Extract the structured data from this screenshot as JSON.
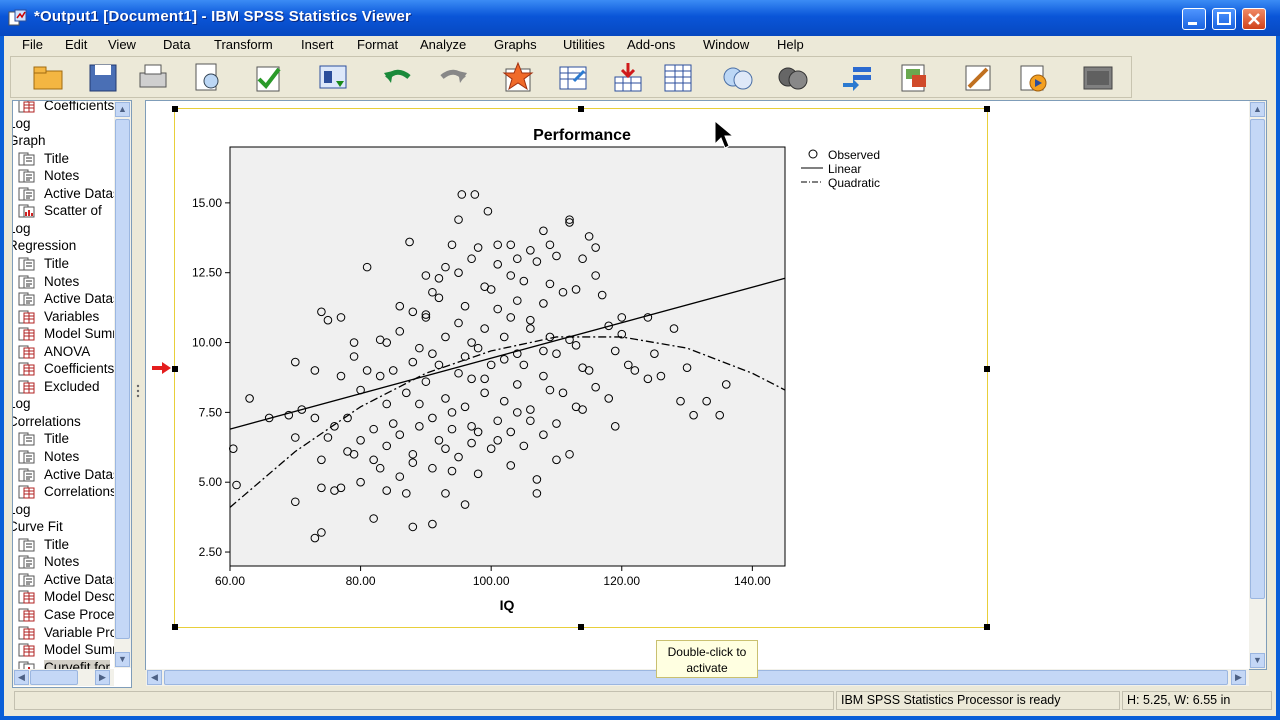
{
  "window": {
    "title": "*Output1 [Document1] - IBM SPSS Statistics Viewer",
    "app_icon": "spss-viewer-icon",
    "controls": [
      "minimize-icon",
      "maximize-icon",
      "close-icon"
    ]
  },
  "menu": [
    "File",
    "Edit",
    "View",
    "Data",
    "Transform",
    "Insert",
    "Format",
    "Analyze",
    "Graphs",
    "Utilities",
    "Add-ons",
    "Window",
    "Help"
  ],
  "toolbar": [
    "open-icon",
    "save-icon",
    "print-icon",
    "print-preview-icon",
    "export-icon",
    "recall-dialog-icon",
    "undo-icon",
    "redo-icon",
    "goto-data-icon",
    "goto-case-icon",
    "variables-icon",
    "insert-output-icon",
    "show-icon",
    "hide-icon",
    "promote-icon",
    "demote-icon",
    "insert-heading-icon",
    "insert-text-icon",
    "designate-window-icon"
  ],
  "nav": {
    "items": [
      {
        "label": "Coefficients",
        "type": "table"
      },
      {
        "label": "Log",
        "type": "log"
      },
      {
        "label": "Graph",
        "type": "section"
      },
      {
        "label": "Title",
        "type": "title"
      },
      {
        "label": "Notes",
        "type": "notes"
      },
      {
        "label": "Active Dataset",
        "type": "notes"
      },
      {
        "label": "Scatter of",
        "type": "chart"
      },
      {
        "label": "Log",
        "type": "log"
      },
      {
        "label": "Regression",
        "type": "section"
      },
      {
        "label": "Title",
        "type": "title"
      },
      {
        "label": "Notes",
        "type": "notes"
      },
      {
        "label": "Active Dataset",
        "type": "notes"
      },
      {
        "label": "Variables",
        "type": "table"
      },
      {
        "label": "Model Summary",
        "type": "table"
      },
      {
        "label": "ANOVA",
        "type": "table"
      },
      {
        "label": "Coefficients",
        "type": "table"
      },
      {
        "label": "Excluded",
        "type": "table"
      },
      {
        "label": "Log",
        "type": "log"
      },
      {
        "label": "Correlations",
        "type": "section"
      },
      {
        "label": "Title",
        "type": "title"
      },
      {
        "label": "Notes",
        "type": "notes"
      },
      {
        "label": "Active Dataset",
        "type": "notes"
      },
      {
        "label": "Correlations",
        "type": "table"
      },
      {
        "label": "Log",
        "type": "log"
      },
      {
        "label": "Curve Fit",
        "type": "section"
      },
      {
        "label": "Title",
        "type": "title"
      },
      {
        "label": "Notes",
        "type": "notes"
      },
      {
        "label": "Active Dataset",
        "type": "notes"
      },
      {
        "label": "Model Description",
        "type": "table"
      },
      {
        "label": "Case Processing",
        "type": "table"
      },
      {
        "label": "Variable Processing",
        "type": "table"
      },
      {
        "label": "Model Summary",
        "type": "table"
      },
      {
        "label": "Curvefit for",
        "type": "chart",
        "selected": true
      }
    ]
  },
  "chart_data": {
    "type": "scatter",
    "title": "Performance",
    "xlabel": "IQ",
    "ylabel": "",
    "xlim": [
      60,
      145
    ],
    "ylim": [
      2,
      17
    ],
    "xticks": [
      "60.00",
      "80.00",
      "100.00",
      "120.00",
      "140.00"
    ],
    "yticks": [
      "2.50",
      "5.00",
      "7.50",
      "10.00",
      "12.50",
      "15.00"
    ],
    "legend": {
      "position": "right",
      "entries": [
        "Observed",
        "Linear",
        "Quadratic"
      ]
    },
    "series": [
      {
        "name": "Linear",
        "style": "solid",
        "x": [
          60,
          145
        ],
        "y": [
          6.9,
          12.3
        ]
      },
      {
        "name": "Quadratic",
        "style": "dash-dot",
        "x": [
          60,
          70,
          80,
          90,
          100,
          110,
          120,
          130,
          140,
          145
        ],
        "y": [
          4.1,
          6.1,
          7.7,
          8.9,
          9.7,
          10.2,
          10.2,
          9.8,
          8.9,
          8.3
        ]
      },
      {
        "name": "Observed",
        "style": "circle",
        "points": [
          [
            95.5,
            15.3
          ],
          [
            97.5,
            15.3
          ],
          [
            99.5,
            14.7
          ],
          [
            112,
            14.4
          ],
          [
            95,
            14.4
          ],
          [
            112,
            14.3
          ],
          [
            108,
            14.0
          ],
          [
            115,
            13.8
          ],
          [
            87.5,
            13.6
          ],
          [
            94,
            13.5
          ],
          [
            101,
            13.5
          ],
          [
            103,
            13.5
          ],
          [
            109,
            13.5
          ],
          [
            116,
            13.4
          ],
          [
            98,
            13.4
          ],
          [
            106,
            13.3
          ],
          [
            110,
            13.1
          ],
          [
            114,
            13.0
          ],
          [
            107,
            12.9
          ],
          [
            93,
            12.7
          ],
          [
            81,
            12.7
          ],
          [
            95,
            12.5
          ],
          [
            103,
            12.4
          ],
          [
            109,
            12.1
          ],
          [
            113,
            11.9
          ],
          [
            100,
            11.9
          ],
          [
            92,
            11.6
          ],
          [
            117,
            11.7
          ],
          [
            104,
            11.5
          ],
          [
            108,
            11.4
          ],
          [
            96,
            11.3
          ],
          [
            88,
            11.1
          ],
          [
            74,
            11.1
          ],
          [
            77,
            10.9
          ],
          [
            90,
            10.9
          ],
          [
            106,
            10.8
          ],
          [
            120,
            10.9
          ],
          [
            124,
            10.9
          ],
          [
            128,
            10.5
          ],
          [
            99,
            10.5
          ],
          [
            86,
            10.4
          ],
          [
            93,
            10.2
          ],
          [
            102,
            10.2
          ],
          [
            109,
            10.2
          ],
          [
            112,
            10.1
          ],
          [
            79,
            10.0
          ],
          [
            84,
            10.0
          ],
          [
            97,
            10.0
          ],
          [
            113,
            9.9
          ],
          [
            119,
            9.7
          ],
          [
            125,
            9.6
          ],
          [
            91,
            9.6
          ],
          [
            104,
            9.6
          ],
          [
            70,
            9.3
          ],
          [
            88,
            9.3
          ],
          [
            100,
            9.2
          ],
          [
            114,
            9.1
          ],
          [
            122,
            9.0
          ],
          [
            130,
            9.1
          ],
          [
            95,
            8.9
          ],
          [
            108,
            8.8
          ],
          [
            77,
            8.8
          ],
          [
            83,
            8.8
          ],
          [
            97,
            8.7
          ],
          [
            90,
            8.6
          ],
          [
            104,
            8.5
          ],
          [
            116,
            8.4
          ],
          [
            124,
            8.7
          ],
          [
            136,
            8.5
          ],
          [
            80,
            8.3
          ],
          [
            87,
            8.2
          ],
          [
            99,
            8.2
          ],
          [
            111,
            8.2
          ],
          [
            63,
            8.0
          ],
          [
            93,
            8.0
          ],
          [
            102,
            7.9
          ],
          [
            129,
            7.9
          ],
          [
            133,
            7.9
          ],
          [
            84,
            7.8
          ],
          [
            96,
            7.7
          ],
          [
            106,
            7.6
          ],
          [
            114,
            7.6
          ],
          [
            69,
            7.4
          ],
          [
            73,
            7.3
          ],
          [
            78,
            7.3
          ],
          [
            91,
            7.3
          ],
          [
            101,
            7.2
          ],
          [
            110,
            7.1
          ],
          [
            131,
            7.4
          ],
          [
            135,
            7.4
          ],
          [
            89,
            7.0
          ],
          [
            94,
            6.9
          ],
          [
            103,
            6.8
          ],
          [
            86,
            6.7
          ],
          [
            108,
            6.7
          ],
          [
            70,
            6.6
          ],
          [
            75,
            6.6
          ],
          [
            80,
            6.5
          ],
          [
            92,
            6.5
          ],
          [
            97,
            6.4
          ],
          [
            119,
            7.0
          ],
          [
            84,
            6.3
          ],
          [
            100,
            6.2
          ],
          [
            78,
            6.1
          ],
          [
            88,
            6.0
          ],
          [
            95,
            5.9
          ],
          [
            82,
            5.8
          ],
          [
            74,
            5.8
          ],
          [
            103,
            5.6
          ],
          [
            91,
            5.5
          ],
          [
            110,
            5.8
          ],
          [
            98,
            5.3
          ],
          [
            86,
            5.2
          ],
          [
            107,
            5.1
          ],
          [
            80,
            5.0
          ],
          [
            60.5,
            6.2
          ],
          [
            61,
            4.9
          ],
          [
            74,
            4.8
          ],
          [
            76,
            4.7
          ],
          [
            84,
            4.7
          ],
          [
            87,
            4.6
          ],
          [
            93,
            4.6
          ],
          [
            107,
            4.6
          ],
          [
            70,
            4.3
          ],
          [
            96,
            4.2
          ],
          [
            82,
            3.7
          ],
          [
            88,
            3.4
          ],
          [
            91,
            3.5
          ],
          [
            74,
            3.2
          ],
          [
            73,
            3.0
          ],
          [
            92,
            12.3
          ],
          [
            99,
            12.0
          ],
          [
            105,
            12.2
          ],
          [
            111,
            11.8
          ],
          [
            101,
            11.2
          ],
          [
            90,
            11.0
          ],
          [
            106,
            10.5
          ],
          [
            103,
            10.9
          ],
          [
            95,
            10.7
          ],
          [
            98,
            9.8
          ],
          [
            110,
            9.6
          ],
          [
            115,
            9.0
          ],
          [
            121,
            9.2
          ],
          [
            126,
            8.8
          ],
          [
            92,
            9.2
          ],
          [
            85,
            9.0
          ],
          [
            105,
            9.2
          ],
          [
            99,
            8.7
          ],
          [
            109,
            8.3
          ],
          [
            118,
            8.0
          ],
          [
            89,
            7.8
          ],
          [
            94,
            7.5
          ],
          [
            104,
            7.5
          ],
          [
            113,
            7.7
          ],
          [
            85,
            7.1
          ],
          [
            97,
            7.0
          ],
          [
            106,
            7.2
          ],
          [
            76,
            7.0
          ],
          [
            82,
            6.9
          ],
          [
            93,
            6.2
          ],
          [
            101,
            6.5
          ],
          [
            112,
            6.0
          ],
          [
            120,
            10.3
          ],
          [
            118,
            10.6
          ],
          [
            116,
            12.4
          ],
          [
            104,
            13.0
          ],
          [
            101,
            12.8
          ],
          [
            97,
            13.0
          ],
          [
            90,
            12.4
          ],
          [
            91,
            11.8
          ],
          [
            86,
            11.3
          ],
          [
            75,
            10.8
          ],
          [
            83,
            10.1
          ],
          [
            89,
            9.8
          ],
          [
            96,
            9.5
          ],
          [
            102,
            9.4
          ],
          [
            108,
            9.7
          ],
          [
            79,
            9.5
          ],
          [
            73,
            9.0
          ],
          [
            81,
            9.0
          ],
          [
            66,
            7.3
          ],
          [
            71,
            7.6
          ],
          [
            98,
            6.8
          ],
          [
            105,
            6.3
          ],
          [
            88,
            5.7
          ],
          [
            94,
            5.4
          ],
          [
            83,
            5.5
          ],
          [
            79,
            6.0
          ],
          [
            77,
            4.8
          ]
        ]
      }
    ]
  },
  "tooltip": "Double-click to activate",
  "status": {
    "processor": "IBM SPSS Statistics Processor is ready",
    "dimensions": "H: 5.25, W: 6.55 in"
  }
}
